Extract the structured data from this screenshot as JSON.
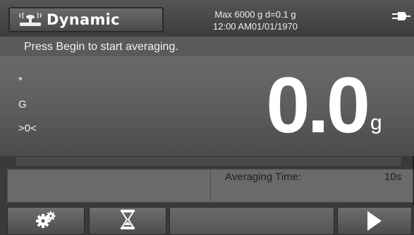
{
  "header": {
    "app_title": "Dynamic",
    "capacity_line": "Max 6000 g  d=0.1 g",
    "datetime_line": "12:00 AM01/01/1970",
    "icons": {
      "app": "scale-mode-icon",
      "power": "power-plug-icon"
    }
  },
  "instruction": "Press Begin to start averaging.",
  "indicators": [
    "*",
    "G",
    ">0<"
  ],
  "weight": {
    "value": "0.0",
    "unit": "g"
  },
  "averaging_progress": 0,
  "info": {
    "label": "Averaging Time:",
    "value": "10s"
  },
  "toolbar": {
    "icons": {
      "settings": "gears-icon",
      "timer": "hourglass-icon",
      "start": "play-icon"
    }
  },
  "colors": {
    "background": "#3a3a3a",
    "display": "#5c5c5c",
    "text": "#ffffff"
  }
}
